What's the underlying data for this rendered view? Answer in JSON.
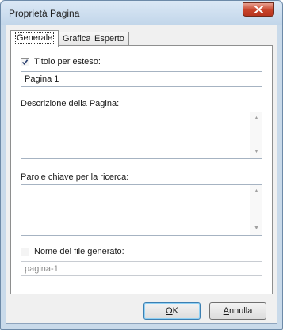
{
  "window": {
    "title": "Proprietà Pagina"
  },
  "tabs": [
    {
      "label": "Generale"
    },
    {
      "label": "Grafica"
    },
    {
      "label": "Esperto"
    }
  ],
  "general": {
    "full_title": {
      "label": "Titolo per esteso:",
      "checked": true,
      "value": "Pagina 1"
    },
    "description": {
      "label": "Descrizione della Pagina:",
      "value": ""
    },
    "keywords": {
      "label": "Parole chiave per la ricerca:",
      "value": ""
    },
    "generated_file": {
      "label": "Nome del file generato:",
      "checked": false,
      "value": "pagina-1"
    }
  },
  "buttons": {
    "ok": {
      "mnemonic": "O",
      "rest": "K"
    },
    "cancel": {
      "mnemonic": "A",
      "rest": "nnulla"
    }
  },
  "colors": {
    "titlebar": "#c9daea",
    "close": "#c7432a",
    "face": "#f0f0f0"
  }
}
